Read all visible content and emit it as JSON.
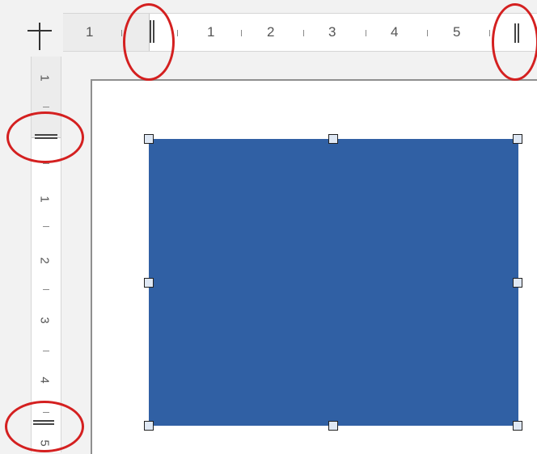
{
  "window": {
    "title": ""
  },
  "ruler_corner": {
    "icon": "crosshair-icon"
  },
  "horizontal_ruler": {
    "labels": [
      "1",
      "1",
      "2",
      "3",
      "4",
      "5"
    ]
  },
  "vertical_ruler": {
    "labels": [
      "1",
      "1",
      "2",
      "3",
      "4",
      "5"
    ]
  },
  "shape": {
    "fill_color": "#3060a4",
    "selected": true
  },
  "annotations": {
    "color": "#d42020",
    "count": 4
  }
}
